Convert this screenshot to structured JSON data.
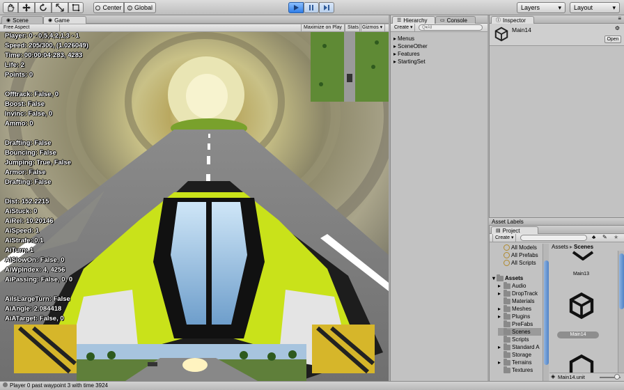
{
  "toolbar": {
    "tools": [
      "hand",
      "move",
      "rotate",
      "scale",
      "rect"
    ],
    "pivot_label": "Center",
    "space_label": "Global",
    "layers_label": "Layers",
    "layout_label": "Layout"
  },
  "scene_tabs": {
    "scene": "Scene",
    "game": "Game"
  },
  "game_bar": {
    "aspect": "Free Aspect",
    "maximize": "Maximize on Play",
    "stats": "Stats",
    "gizmos": "Gizmos"
  },
  "debug_lines": [
    "Player: 0 - 0,5,4,2,1,3 - 1",
    "Speed: 205/300, (1.026049)",
    "Time: 00:00:04:283, 4283",
    "Life: 2",
    "Points: 0",
    "",
    "Offtrack: False, 0",
    "Boost: False",
    "Invinc: False, 0",
    "Ammo: 0",
    "",
    "Drafting: False",
    "Bouncing: False",
    "Jumping: True, False",
    "Armor: False",
    "Drafting: False",
    "",
    "Dist: 152.2215",
    "AiStuck: 0",
    "AiRel: 10.20146",
    "AiSpeed: 1",
    "AiStrafe: 0.1",
    "AiTurn: 1",
    "AiSlowOn: False, 0",
    "AiWpIndex: 4, 4256",
    "AiPassing: False, 0, 0",
    "",
    "AiIsLargeTurn: False",
    "AiAngle: 2.084418",
    "AiATarget: False, 0"
  ],
  "hierarchy": {
    "tab": "Hierarchy",
    "console_tab": "Console",
    "create": "Create",
    "search_placeholder": "Q▾All",
    "items": [
      "Menus",
      "SceneOther",
      "Features",
      "StartingSet"
    ]
  },
  "inspector": {
    "tab": "Inspector",
    "object_name": "Main14",
    "open_button": "Open"
  },
  "asset_labels": {
    "title": "Asset Labels"
  },
  "project": {
    "tab": "Project",
    "create": "Create",
    "favorites": [
      "All Models",
      "All Prefabs",
      "All Scripts"
    ],
    "assets_root": "Assets",
    "folders": [
      "Audio",
      "DropTrack",
      "Materials",
      "Meshes",
      "Plugins",
      "PreFabs",
      "Scenes",
      "Scripts",
      "Standard A",
      "Storage",
      "Terrains",
      "Textures"
    ],
    "breadcrumb_root": "Assets",
    "breadcrumb_current": "Scenes",
    "grid_items": [
      "Main13",
      "Main14"
    ],
    "bottom_file": "Main14.unit"
  },
  "status_bar": {
    "message": "Player 0 past waypoint 3 with time 3924"
  },
  "colors": {
    "play_blue": "#2f7ee8",
    "ship_lime": "#c9e21a",
    "selection": "#8aa6c8"
  }
}
